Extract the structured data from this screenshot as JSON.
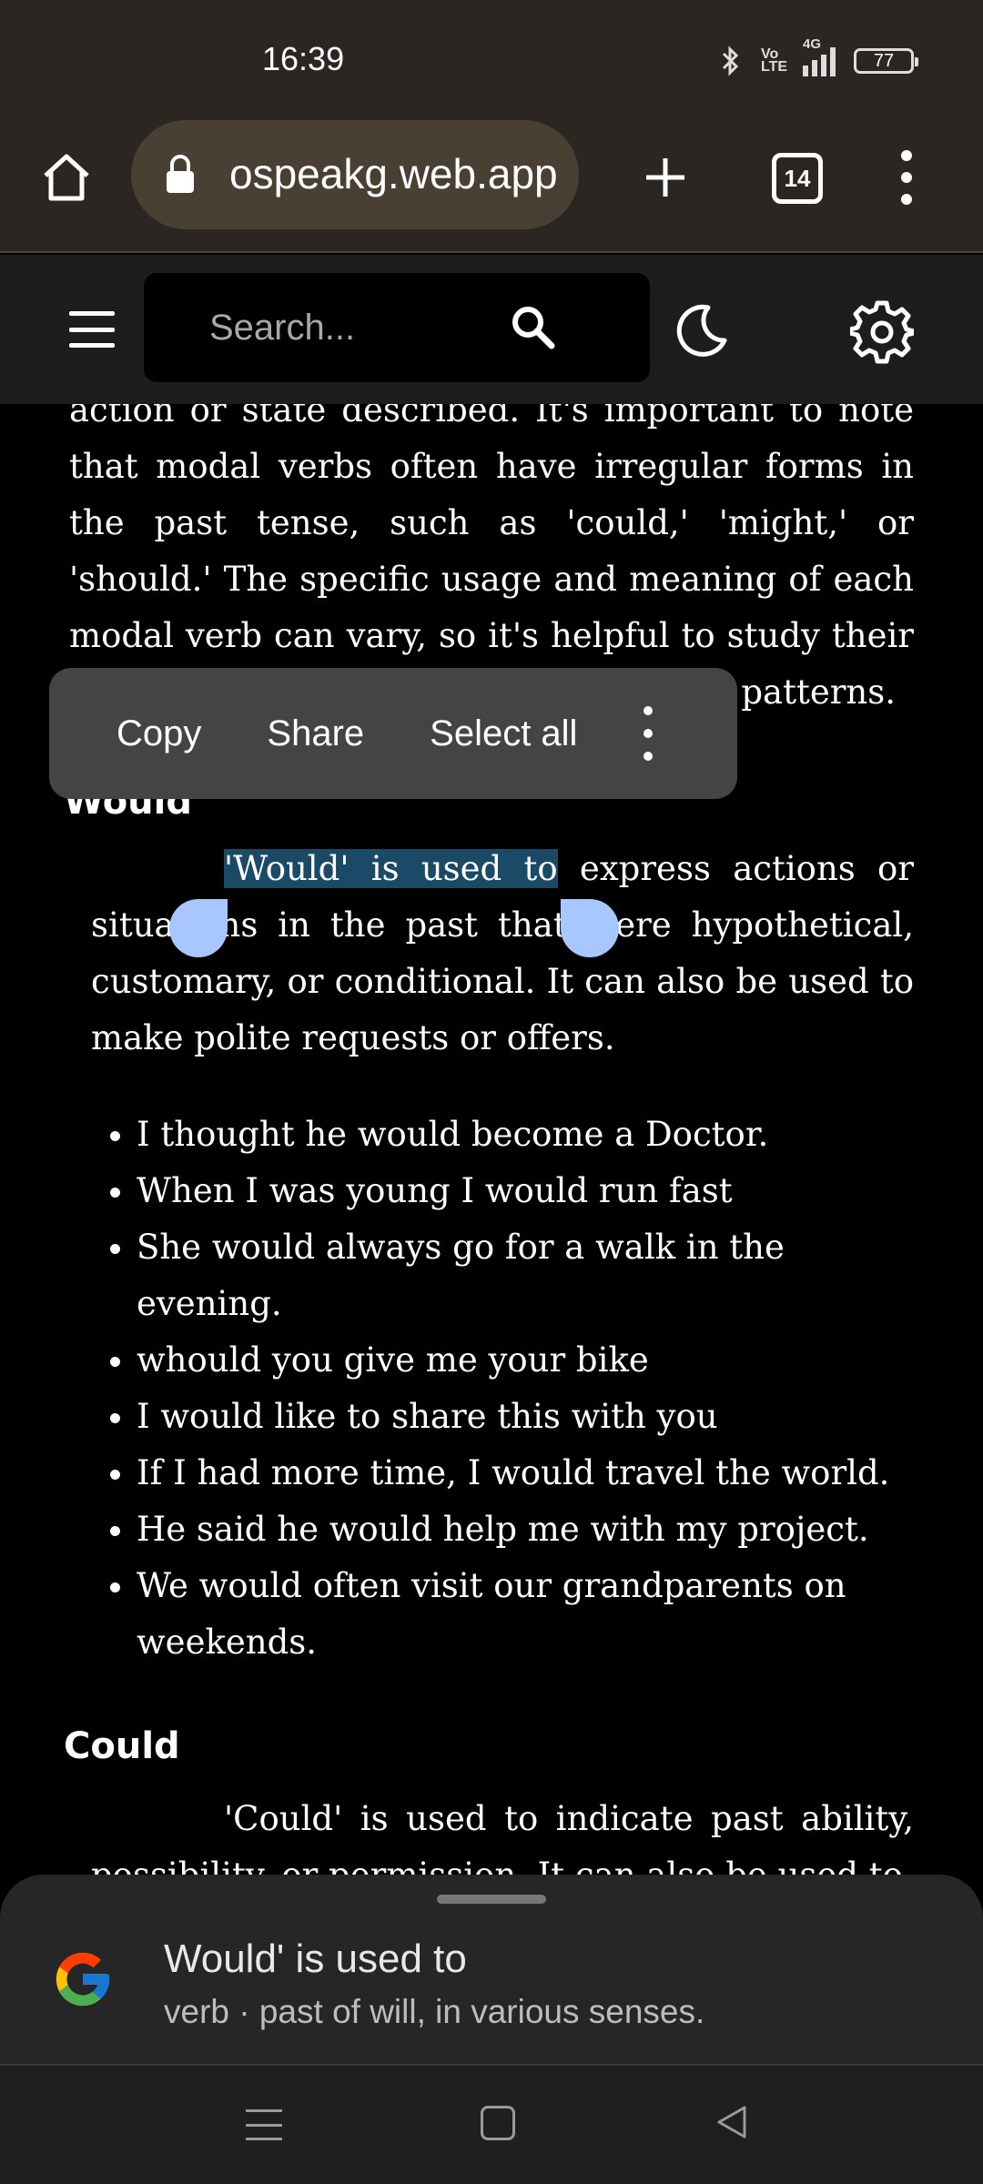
{
  "status_bar": {
    "time": "16:39",
    "network": "4G",
    "volte": "Vo LTE",
    "battery": "77"
  },
  "browser": {
    "url": "ospeakg.web.app",
    "tab_count": "14"
  },
  "site_header": {
    "search_placeholder": "Search..."
  },
  "article": {
    "intro_lines": "action or state described. It's important to note that modal verbs often have irregular forms in the past tense, such as 'could,' 'might,' or 'should.' The specific usage and meaning of each modal verb can vary, so it's helpful to study their usage in context and practice common patterns.",
    "would_heading": "Would",
    "would_selected": "'Would' is used to",
    "would_rest": " express actions or situations in the past that were hypothetical, customary, or conditional. It can also be used to make polite requests or offers.",
    "would_examples": [
      "I thought he would become a Doctor.",
      "When I was young I would run fast",
      "She would always go for a walk in the evening.",
      "whould you give me your bike",
      "I would like to share this with you",
      "If I had more time, I would travel the world.",
      "He said he would help me with my project.",
      "We would often visit our grandparents on weekends."
    ],
    "could_heading": "Could",
    "could_text": "'Could' is used to indicate past ability, possibility, or permission. It can also be used to"
  },
  "context_menu": {
    "copy": "Copy",
    "share": "Share",
    "select_all": "Select all"
  },
  "definition_sheet": {
    "term": "Would' is used to",
    "definition": "verb · past of will, in various senses."
  }
}
